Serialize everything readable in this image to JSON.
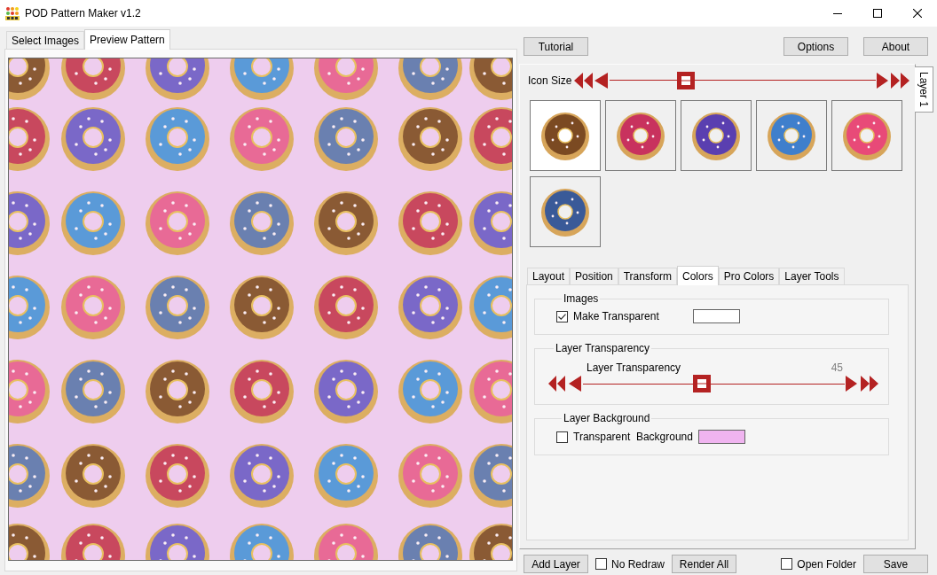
{
  "window": {
    "title": "POD Pattern Maker v1.2"
  },
  "main_tabs": [
    {
      "label": "Select Images",
      "selected": false
    },
    {
      "label": "Preview Pattern",
      "selected": true
    }
  ],
  "top_buttons": {
    "left": [
      "Tutorial"
    ],
    "right": [
      "Options",
      "About"
    ]
  },
  "layer_tabs": [
    {
      "label": "Layer 1",
      "selected": true
    }
  ],
  "icon_size": {
    "label": "Icon Size",
    "level": 0.27
  },
  "thumbnails": [
    {
      "selected": true,
      "color": "#7b4a22"
    },
    {
      "selected": false,
      "color": "#c8325e"
    },
    {
      "selected": false,
      "color": "#5a3fb0"
    },
    {
      "selected": false,
      "color": "#3f7fcc"
    },
    {
      "selected": false,
      "color": "#e84a78"
    },
    {
      "selected": false,
      "color": "#3a5a98"
    }
  ],
  "settings_tabs": [
    {
      "label": "Layout",
      "selected": false
    },
    {
      "label": "Position",
      "selected": false
    },
    {
      "label": "Transform",
      "selected": false
    },
    {
      "label": "Colors",
      "selected": true
    },
    {
      "label": "Pro Colors",
      "selected": false
    },
    {
      "label": "Layer Tools",
      "selected": false
    }
  ],
  "images_group": {
    "title": "Images",
    "checkbox": {
      "label": "Make Transparent",
      "checked": true
    },
    "color": "#ffffff"
  },
  "transparency_group": {
    "title": "Layer Transparency",
    "label": "Layer Transparency",
    "reading": "45",
    "level": 0.45
  },
  "background_group": {
    "title": "Layer Background",
    "checkbox": {
      "label": "Transparent  Background",
      "checked": false
    },
    "color": "#f0b4f0"
  },
  "bottom_bar": {
    "left": [
      {
        "kind": "button",
        "label": "Add Layer"
      },
      {
        "kind": "checkbox",
        "label": "No Redraw",
        "checked": false
      },
      {
        "kind": "button",
        "label": "Render All"
      }
    ],
    "right": [
      {
        "kind": "checkbox",
        "label": "Open Folder",
        "checked": false
      },
      {
        "kind": "button",
        "label": "Save"
      }
    ]
  }
}
